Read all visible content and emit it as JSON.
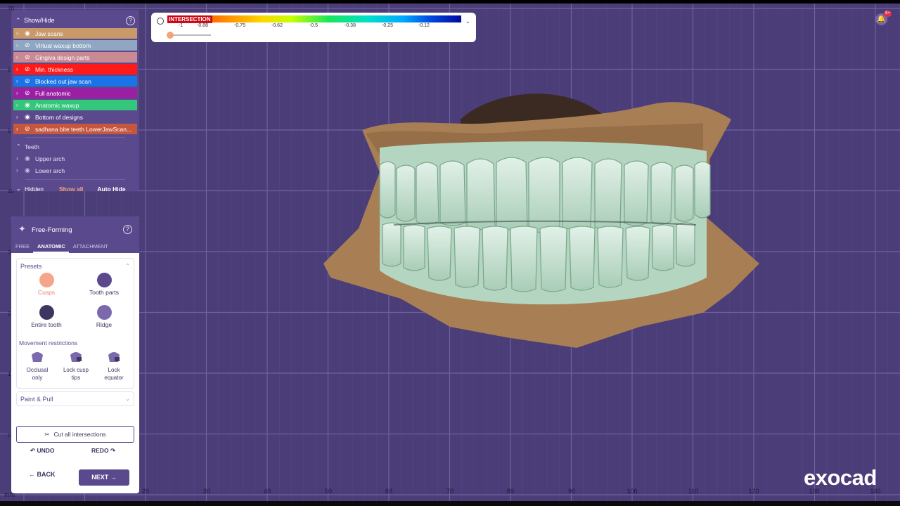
{
  "viewport": {
    "background": "#4b3d77",
    "unit_label": "mm",
    "x_ticks": [
      "20",
      "30",
      "40",
      "50",
      "60",
      "70",
      "80",
      "90",
      "100",
      "110",
      "120",
      "130",
      "140"
    ],
    "y_ticks": [
      "70",
      "6",
      "5",
      "40",
      "3",
      "2",
      "1",
      "0"
    ]
  },
  "show_hide": {
    "title": "Show/Hide",
    "items": [
      {
        "label": "Jaw scans",
        "color": "#c89a6a",
        "visible": true
      },
      {
        "label": "Virtual waxup bottom",
        "color": "#8fa7c2",
        "visible": false
      },
      {
        "label": "Gingiva design parts",
        "color": "#c98a93",
        "visible": false
      },
      {
        "label": "Min. thickness",
        "color": "#ff1a1a",
        "visible": false
      },
      {
        "label": "Blocked out jaw scan",
        "color": "#1a73e8",
        "visible": false
      },
      {
        "label": "Full anatomic",
        "color": "#9b1fa3",
        "visible": false
      },
      {
        "label": "Anatomic waxup",
        "color": "#34c77b",
        "visible": true
      },
      {
        "label": "Bottom of designs",
        "color": "#5a4a8d",
        "visible": true
      },
      {
        "label": "sadhana bite teeth LowerJawScan...",
        "color": "#c6573f",
        "visible": false
      }
    ],
    "teeth_title": "Teeth",
    "teeth": [
      {
        "label": "Upper arch"
      },
      {
        "label": "Lower arch"
      }
    ],
    "hidden_label": "Hidden",
    "show_all": "Show all",
    "auto_hide": "Auto Hide"
  },
  "scale": {
    "title": "INTERSECTION",
    "ticks": [
      "-1",
      "-0.88",
      "-0.75",
      "-0.62",
      "-0.5",
      "-0.38",
      "-0.25",
      "-0.12"
    ]
  },
  "notifications": {
    "badge": "9+"
  },
  "free_forming": {
    "title": "Free-Forming",
    "tabs": [
      "FREE",
      "ANATOMIC",
      "ATTACHMENT"
    ],
    "active_tab": "ANATOMIC",
    "presets_title": "Presets",
    "presets": [
      {
        "label": "Cusps",
        "active": true
      },
      {
        "label": "Tooth parts",
        "active": false
      },
      {
        "label": "Entire tooth",
        "active": false
      },
      {
        "label": "Ridge",
        "active": false
      }
    ],
    "movement_title": "Movement restrictions",
    "restrictions": [
      {
        "line1": "Occlusal",
        "line2": "only"
      },
      {
        "line1": "Lock cusp",
        "line2": "tips"
      },
      {
        "line1": "Lock",
        "line2": "equator"
      }
    ],
    "paint_pull": "Paint & Pull",
    "cut_all": "Cut all intersections",
    "undo": "UNDO",
    "redo": "REDO",
    "back": "BACK",
    "next": "NEXT"
  },
  "brand": {
    "logo": "exocad"
  }
}
